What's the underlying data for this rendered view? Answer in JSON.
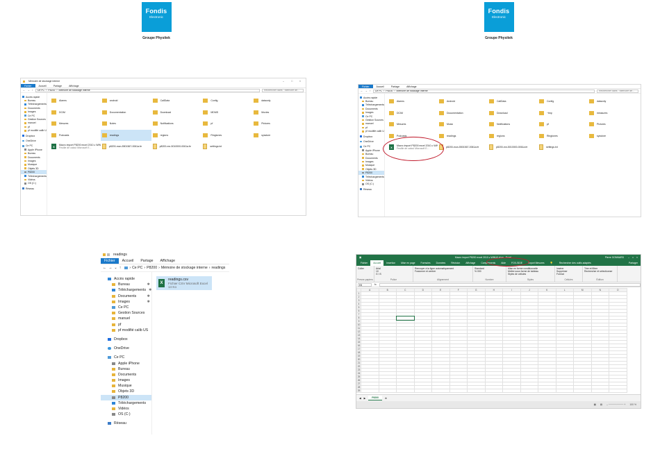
{
  "logo": {
    "brand": "Fondis",
    "tag": "Electronic",
    "group": "Groupe Physitek"
  },
  "explorer": {
    "title": "Mémoire de stockage interne",
    "ribbon": [
      "Fichier",
      "Accueil",
      "Partage",
      "Affichage"
    ],
    "path": [
      "Ce PC",
      "P8200",
      "Mémoire de stockage interne"
    ],
    "search_placeholder": "Rechercher dans : Mémoire de...",
    "sidebar": [
      {
        "label": "Accès rapide",
        "icon": "star-icon",
        "level": 1
      },
      {
        "label": "Bureau",
        "icon": "folder-icon",
        "level": 2
      },
      {
        "label": "Téléchargements",
        "icon": "download-icon",
        "level": 2
      },
      {
        "label": "Documents",
        "icon": "folder-icon",
        "level": 2
      },
      {
        "label": "Images",
        "icon": "folder-icon",
        "level": 2
      },
      {
        "label": "Ce PC",
        "icon": "pc-icon",
        "level": 2
      },
      {
        "label": "Gestion Sources",
        "icon": "folder-icon",
        "level": 2
      },
      {
        "label": "manuel",
        "icon": "folder-icon",
        "level": 2
      },
      {
        "label": "pf",
        "icon": "folder-icon",
        "level": 2
      },
      {
        "label": "pf modifié calib US",
        "icon": "folder-icon",
        "level": 2
      },
      {
        "label": "Dropbox",
        "icon": "dropbox-icon",
        "level": 1,
        "gap": true
      },
      {
        "label": "OneDrive",
        "icon": "cloud-icon",
        "level": 1,
        "gap": true
      },
      {
        "label": "Ce PC",
        "icon": "pc-icon",
        "level": 1,
        "gap": true
      },
      {
        "label": "Apple iPhone",
        "icon": "phone-icon",
        "level": 2
      },
      {
        "label": "Bureau",
        "icon": "folder-icon",
        "level": 2
      },
      {
        "label": "Documents",
        "icon": "folder-icon",
        "level": 2
      },
      {
        "label": "Images",
        "icon": "folder-icon",
        "level": 2
      },
      {
        "label": "Musique",
        "icon": "folder-icon",
        "level": 2
      },
      {
        "label": "Objets 3D",
        "icon": "folder-icon",
        "level": 2
      },
      {
        "label": "P8200",
        "icon": "device-icon",
        "level": 2,
        "selected": true
      },
      {
        "label": "Téléchargements",
        "icon": "download-icon",
        "level": 2
      },
      {
        "label": "Vidéos",
        "icon": "folder-icon",
        "level": 2
      },
      {
        "label": "OS (C:)",
        "icon": "drive-icon",
        "level": 2
      },
      {
        "label": "Réseau",
        "icon": "network-icon",
        "level": 1,
        "gap": true
      }
    ],
    "folders_left": [
      {
        "name": "Alarms",
        "type": "folder"
      },
      {
        "name": "android",
        "type": "folder"
      },
      {
        "name": "CallData",
        "type": "folder"
      },
      {
        "name": "Config",
        "type": "folder"
      },
      {
        "name": "dataonly",
        "type": "folder"
      },
      {
        "name": "DCIM",
        "type": "folder"
      },
      {
        "name": "Documentation",
        "type": "folder"
      },
      {
        "name": "Download",
        "type": "folder"
      },
      {
        "name": "MDMS",
        "type": "folder"
      },
      {
        "name": "Movies",
        "type": "folder"
      },
      {
        "name": "Mesures",
        "type": "folder"
      },
      {
        "name": "Notes",
        "type": "folder"
      },
      {
        "name": "Notifications",
        "type": "folder"
      },
      {
        "name": "pf",
        "type": "folder"
      },
      {
        "name": "Pictures",
        "type": "folder"
      },
      {
        "name": "Podcasts",
        "type": "folder"
      },
      {
        "name": "readings",
        "type": "folder",
        "selected": true
      },
      {
        "name": "regions",
        "type": "folder"
      },
      {
        "name": "Ringtones",
        "type": "folder"
      },
      {
        "name": "sysstore",
        "type": "folder"
      },
      {
        "name": "Macro import P8200 excel 2010 ≥ WIN10.xlsm",
        "sub": "Feuille de calcul Microsoft E...",
        "type": "excel"
      },
      {
        "name": "p8200-mon-5501567-0061a.fe",
        "type": "doc"
      },
      {
        "name": "p8200-mn-5010000-0061a.fe",
        "type": "doc"
      },
      {
        "name": "settings.txt",
        "type": "doc"
      }
    ],
    "folders_right": [
      {
        "name": "Alarms",
        "type": "folder"
      },
      {
        "name": "Android",
        "type": "folder"
      },
      {
        "name": "CallData",
        "type": "folder"
      },
      {
        "name": "Config",
        "type": "folder"
      },
      {
        "name": "dataonly",
        "type": "folder"
      },
      {
        "name": "DCIM",
        "type": "folder"
      },
      {
        "name": "Documentation",
        "type": "folder"
      },
      {
        "name": "Download",
        "type": "folder"
      },
      {
        "name": "~tmp",
        "type": "folder"
      },
      {
        "name": "measures",
        "type": "folder"
      },
      {
        "name": "Mesures",
        "type": "folder"
      },
      {
        "name": "Music",
        "type": "folder"
      },
      {
        "name": "Notifications",
        "type": "folder"
      },
      {
        "name": "pf",
        "type": "folder"
      },
      {
        "name": "Pictures",
        "type": "folder"
      },
      {
        "name": "Podcasts",
        "type": "folder"
      },
      {
        "name": "readings",
        "type": "folder"
      },
      {
        "name": "regions",
        "type": "folder"
      },
      {
        "name": "Ringtones",
        "type": "folder"
      },
      {
        "name": "sysstore",
        "type": "folder"
      },
      {
        "name": "Macro import P8200 excel 2010 ≥ WIN10.xlsm",
        "sub": "Feuille de calcul Microsoft E...",
        "type": "excel"
      },
      {
        "name": "p8200-mon-5501567-0061a.fe",
        "type": "doc"
      },
      {
        "name": "p8200-mn-5010000-0061a.fe",
        "type": "doc"
      },
      {
        "name": "settings.txt",
        "type": "doc"
      }
    ]
  },
  "readings_window": {
    "title": "readings",
    "ribbon": [
      "Fichier",
      "Accueil",
      "Partage",
      "Affichage"
    ],
    "path": [
      "Ce PC",
      "P8200",
      "Mémoire de stockage interne",
      "readings"
    ],
    "file": {
      "name": "readings.csv",
      "type": "Fichier CSV Microsoft Excel",
      "size": "14 Ko"
    }
  },
  "excel": {
    "title": "Macro import P8200 excel 2010 ≥ WIN10.xlsm - Excel",
    "user": "Pierre GONNARD",
    "tabs": [
      "Fichier",
      "Accueil",
      "Insertion",
      "Mise en page",
      "Formules",
      "Données",
      "Révision",
      "Affichage",
      "Compléments",
      "Aide",
      "FOX-SIDE",
      "Import Mesures",
      "Rechercher des outils adaptés",
      "Partager"
    ],
    "active_tab": "Accueil",
    "highlight_tab": "Import Mesures",
    "ribbon_groups": [
      {
        "label": "Presse-papiers",
        "items": [
          "Coller"
        ]
      },
      {
        "label": "Police",
        "items": [
          "Arial",
          "10",
          "G I S"
        ]
      },
      {
        "label": "Alignement",
        "items": [
          "Renvoyer à la ligne automatiquement",
          "Fusionner et centrer"
        ]
      },
      {
        "label": "Nombre",
        "items": [
          "Standard",
          "% 000"
        ]
      },
      {
        "label": "Styles",
        "items": [
          "Mise en forme conditionnelle",
          "Mettre sous forme de tableau",
          "Styles de cellules"
        ]
      },
      {
        "label": "Cellules",
        "items": [
          "Insérer",
          "Supprimer",
          "Format"
        ]
      },
      {
        "label": "Édition",
        "items": [
          "Trier et filtrer",
          "Rechercher et sélectionner"
        ]
      }
    ],
    "name_box": "E8",
    "columns": [
      "A",
      "B",
      "C",
      "D",
      "E",
      "F",
      "G",
      "H",
      "I",
      "J",
      "K",
      "L",
      "M",
      "N",
      "O"
    ],
    "row_count": 29,
    "sheet_tab": "P8200",
    "zoom": "100 %"
  }
}
